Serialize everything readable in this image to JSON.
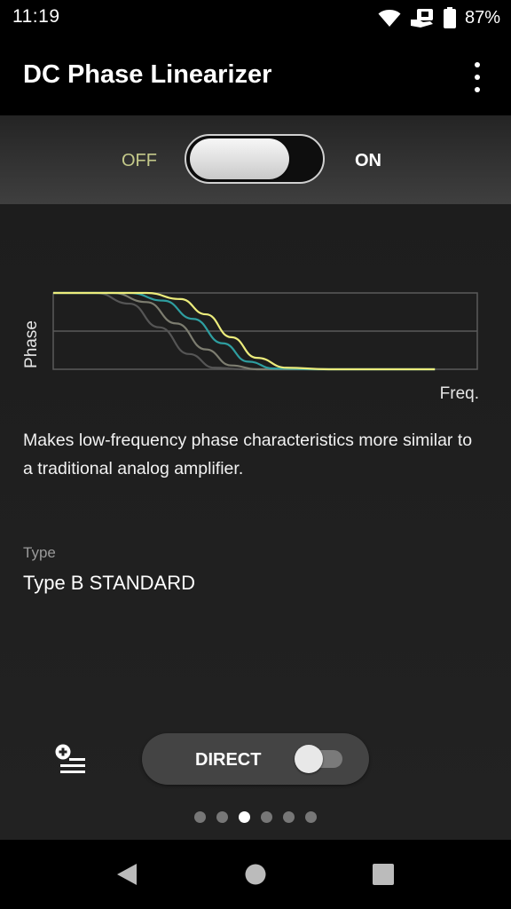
{
  "status_bar": {
    "time": "11:19",
    "battery_percent": "87%",
    "icons": [
      "wifi-icon",
      "notification-icon",
      "battery-icon"
    ]
  },
  "app_bar": {
    "title": "DC Phase Linearizer",
    "menu_icon": "more-vert-icon"
  },
  "main_toggle": {
    "off_label": "OFF",
    "on_label": "ON",
    "state": "off"
  },
  "chart_data": {
    "type": "line",
    "title": "",
    "xlabel": "Freq.",
    "ylabel": "Phase",
    "grid": true,
    "series": [
      {
        "color": "#ecec7c",
        "points": [
          [
            0,
            1
          ],
          [
            0.22,
            1
          ],
          [
            0.3,
            0.92
          ],
          [
            0.36,
            0.72
          ],
          [
            0.42,
            0.42
          ],
          [
            0.48,
            0.15
          ],
          [
            0.55,
            0.02
          ],
          [
            0.65,
            0
          ],
          [
            0.9,
            0
          ]
        ]
      },
      {
        "color": "#2e9ea0",
        "points": [
          [
            0,
            1
          ],
          [
            0.18,
            1
          ],
          [
            0.26,
            0.9
          ],
          [
            0.33,
            0.66
          ],
          [
            0.4,
            0.34
          ],
          [
            0.46,
            0.1
          ],
          [
            0.52,
            0.01
          ],
          [
            0.62,
            0
          ],
          [
            0.9,
            0
          ]
        ]
      },
      {
        "color": "#7d7d70",
        "points": [
          [
            0,
            1
          ],
          [
            0.14,
            1
          ],
          [
            0.22,
            0.88
          ],
          [
            0.29,
            0.6
          ],
          [
            0.36,
            0.26
          ],
          [
            0.42,
            0.05
          ],
          [
            0.48,
            0
          ],
          [
            0.9,
            0
          ]
        ]
      },
      {
        "color": "#555555",
        "points": [
          [
            0,
            1
          ],
          [
            0.1,
            1
          ],
          [
            0.18,
            0.86
          ],
          [
            0.25,
            0.55
          ],
          [
            0.32,
            0.2
          ],
          [
            0.38,
            0.02
          ],
          [
            0.45,
            0
          ],
          [
            0.9,
            0
          ]
        ]
      }
    ]
  },
  "description": "Makes low-frequency phase characteristics more similar to a traditional analog amplifier.",
  "type_setting": {
    "label": "Type",
    "value": "Type B STANDARD"
  },
  "bottom_controls": {
    "add_icon": "playlist-add-icon",
    "direct_label": "DIRECT",
    "direct_state": "off"
  },
  "page_indicator": {
    "count": 6,
    "active_index": 2
  },
  "nav_bar": {
    "icons": [
      "back-icon",
      "home-icon",
      "recents-icon"
    ]
  }
}
